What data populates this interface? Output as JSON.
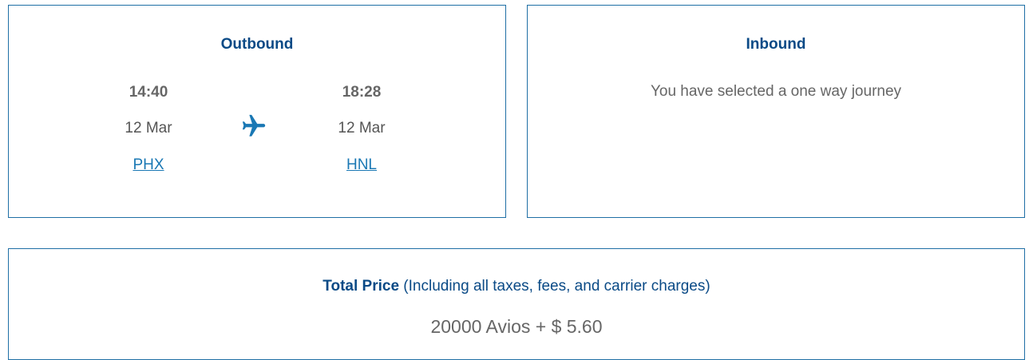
{
  "outbound": {
    "title": "Outbound",
    "departure": {
      "time": "14:40",
      "date": "12 Mar",
      "airport": "PHX"
    },
    "arrival": {
      "time": "18:28",
      "date": "12 Mar",
      "airport": "HNL"
    },
    "icon": "plane-icon"
  },
  "inbound": {
    "title": "Inbound",
    "message": "You have selected a one way journey"
  },
  "price": {
    "label": "Total Price",
    "note": " (Including all taxes, fees, and carrier charges)",
    "value": "20000 Avios + $ 5.60"
  },
  "colors": {
    "border": "#1f6fa5",
    "title": "#0a4a86",
    "link": "#1a78b4",
    "icon": "#1a78b4"
  }
}
